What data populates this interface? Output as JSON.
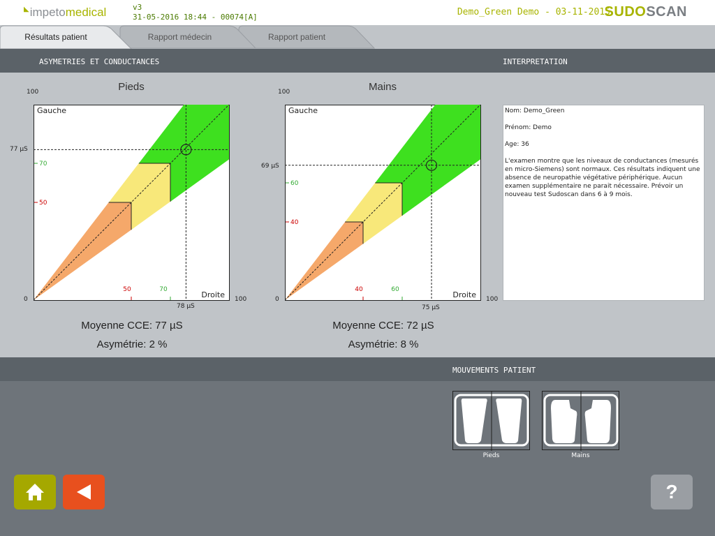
{
  "header": {
    "logo_part1": "impeto",
    "logo_part2": "medical",
    "version": "v3",
    "datetime": "31-05-2016 18:44 - 00074[A]",
    "patient": "Demo_Green Demo -  03-11-2015",
    "brand_part1": "SUDO",
    "brand_part2": "SCAN"
  },
  "tabs": [
    {
      "label": "Résultats patient",
      "active": true
    },
    {
      "label": "Rapport médecin",
      "active": false
    },
    {
      "label": "Rapport patient",
      "active": false
    }
  ],
  "sections": {
    "asym_title": "ASYMETRIES ET CONDUCTANCES",
    "interp_title": "INTERPRETATION",
    "movements_title": "MOUVEMENTS PATIENT"
  },
  "charts": {
    "pieds": {
      "title": "Pieds",
      "y_label": "Gauche",
      "x_label": "Droite",
      "axis_max": "100",
      "axis_min": "0",
      "left_value_label": "77 µS",
      "bottom_value_label": "78 µS",
      "left_value": 77,
      "right_value": 78,
      "red_threshold": 50,
      "green_threshold": 70,
      "red_label": "50",
      "green_label": "70",
      "mean": "Moyenne CCE: 77 µS",
      "asym": "Asymétrie: 2 %"
    },
    "mains": {
      "title": "Mains",
      "y_label": "Gauche",
      "x_label": "Droite",
      "axis_max": "100",
      "axis_min": "0",
      "left_value_label": "69 µS",
      "bottom_value_label": "75 µS",
      "left_value": 69,
      "right_value": 75,
      "red_threshold": 40,
      "green_threshold": 60,
      "red_label": "40",
      "green_label": "60",
      "mean": "Moyenne CCE: 72 µS",
      "asym": "Asymétrie: 8 %"
    }
  },
  "interpretation": {
    "nom": "Nom: Demo_Green",
    "prenom": "Prénom: Demo",
    "age": "Age: 36",
    "text": "L'examen montre que les niveaux de conductances (mesurés en micro-Siemens) sont normaux. Ces résultats indiquent une absence de neuropathie végétative périphérique. Aucun examen supplémentaire ne parait nécessaire. Prévoir un nouveau test Sudoscan dans 6 à 9 mois."
  },
  "movements": {
    "pieds_label": "Pieds",
    "mains_label": "Mains"
  },
  "buttons": {
    "help_label": "?"
  },
  "colors": {
    "green_zone": "#3ee01f",
    "yellow_zone": "#f8e87a",
    "orange_zone": "#f5a86a",
    "red_tick": "#cc0000",
    "green_tick": "#33aa33",
    "accent": "#a8b400"
  }
}
